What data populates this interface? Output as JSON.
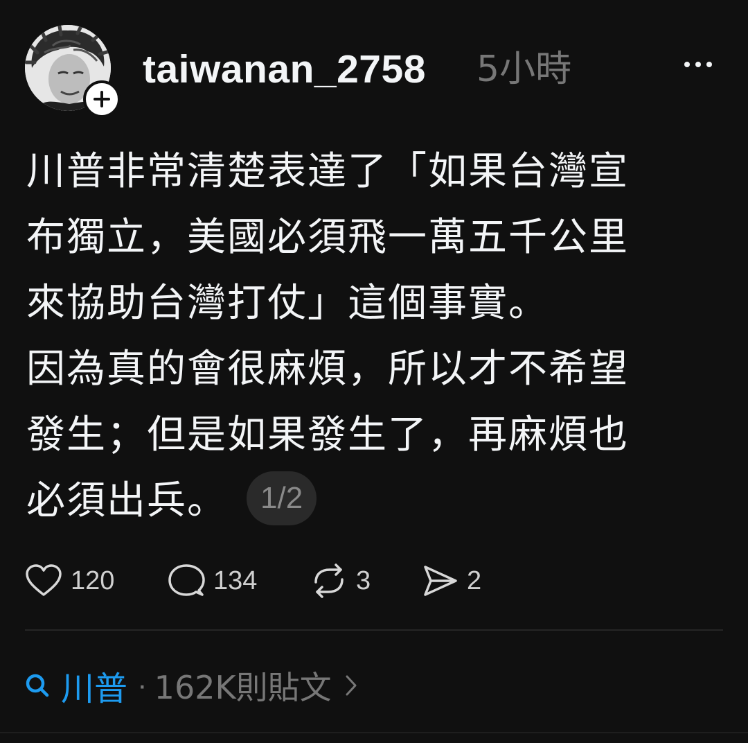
{
  "header": {
    "username": "taiwanan_2758",
    "timestamp": "5小時"
  },
  "post": {
    "lines": [
      "川普非常清楚表達了「如果台灣宣",
      "布獨立，美國必須飛一萬五千公里",
      "來協助台灣打仗」這個事實。",
      "因為真的會很麻煩，所以才不希望",
      "發生；但是如果發生了，再麻煩也",
      "必須出兵。"
    ],
    "page_indicator": "1/2"
  },
  "actions": {
    "likes": "120",
    "replies": "134",
    "reposts": "3",
    "shares": "2"
  },
  "search": {
    "term": "川普",
    "separator": "·",
    "count": "162K則貼文"
  },
  "colors": {
    "background": "#101010",
    "text": "#f3f5f7",
    "muted": "#777777",
    "link": "#1d9bf0"
  },
  "icons": {
    "more": "more-dots-icon",
    "follow": "plus-icon",
    "like": "heart-icon",
    "reply": "comment-icon",
    "repost": "repost-icon",
    "share": "send-icon",
    "search": "search-icon",
    "chevron": "chevron-right-icon"
  }
}
